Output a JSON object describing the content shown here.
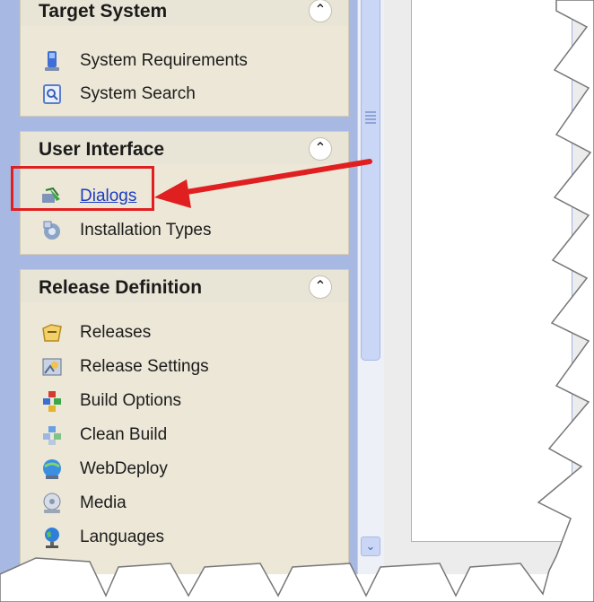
{
  "sections": [
    {
      "title": "Target System",
      "collapse_icon": "chevron-double-up-icon",
      "items": [
        {
          "label": "System Requirements",
          "icon": "system-requirements-icon"
        },
        {
          "label": "System Search",
          "icon": "system-search-icon"
        }
      ]
    },
    {
      "title": "User Interface",
      "collapse_icon": "chevron-double-up-icon",
      "items": [
        {
          "label": "Dialogs",
          "icon": "dialogs-icon",
          "highlighted": true
        },
        {
          "label": "Installation Types",
          "icon": "installation-types-icon"
        }
      ]
    },
    {
      "title": "Release Definition",
      "collapse_icon": "chevron-double-up-icon",
      "items": [
        {
          "label": "Releases",
          "icon": "releases-icon"
        },
        {
          "label": "Release Settings",
          "icon": "release-settings-icon"
        },
        {
          "label": "Build Options",
          "icon": "build-options-icon"
        },
        {
          "label": "Clean Build",
          "icon": "clean-build-icon"
        },
        {
          "label": "WebDeploy",
          "icon": "webdeploy-icon"
        },
        {
          "label": "Media",
          "icon": "media-icon"
        },
        {
          "label": "Languages",
          "icon": "languages-icon"
        }
      ]
    }
  ],
  "annotation": {
    "highlight_color": "#e02020",
    "arrow_color": "#e02020"
  },
  "colors": {
    "panel_background": "#a7b9e3",
    "section_background": "#ece7d7",
    "link": "#1d3cc0"
  }
}
